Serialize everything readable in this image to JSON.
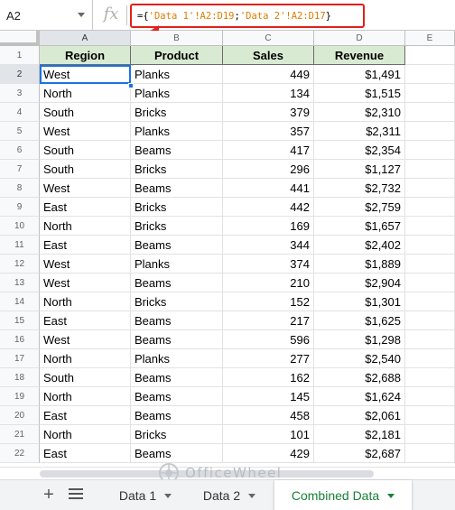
{
  "formula_bar": {
    "name_box": "A2",
    "fx_label": "fx",
    "formula_prefix": "={",
    "ref1": "'Data 1'!A2:D19",
    "separator": ";",
    "ref2": "'Data 2'!A2:D17",
    "formula_suffix": "}",
    "highlight_color": "#e0201a"
  },
  "columns": [
    "A",
    "B",
    "C",
    "D",
    "E"
  ],
  "headers": {
    "region": "Region",
    "product": "Product",
    "sales": "Sales",
    "revenue": "Revenue"
  },
  "header_fill": "#d9ead3",
  "rows": [
    {
      "n": "2",
      "region": "West",
      "product": "Planks",
      "sales": "449",
      "revenue": "$1,491"
    },
    {
      "n": "3",
      "region": "North",
      "product": "Planks",
      "sales": "134",
      "revenue": "$1,515"
    },
    {
      "n": "4",
      "region": "South",
      "product": "Bricks",
      "sales": "379",
      "revenue": "$2,310"
    },
    {
      "n": "5",
      "region": "West",
      "product": "Planks",
      "sales": "357",
      "revenue": "$2,311"
    },
    {
      "n": "6",
      "region": "South",
      "product": "Beams",
      "sales": "417",
      "revenue": "$2,354"
    },
    {
      "n": "7",
      "region": "South",
      "product": "Bricks",
      "sales": "296",
      "revenue": "$1,127"
    },
    {
      "n": "8",
      "region": "West",
      "product": "Beams",
      "sales": "441",
      "revenue": "$2,732"
    },
    {
      "n": "9",
      "region": "East",
      "product": "Bricks",
      "sales": "442",
      "revenue": "$2,759"
    },
    {
      "n": "10",
      "region": "North",
      "product": "Bricks",
      "sales": "169",
      "revenue": "$1,657"
    },
    {
      "n": "11",
      "region": "East",
      "product": "Beams",
      "sales": "344",
      "revenue": "$2,402"
    },
    {
      "n": "12",
      "region": "West",
      "product": "Planks",
      "sales": "374",
      "revenue": "$1,889"
    },
    {
      "n": "13",
      "region": "West",
      "product": "Beams",
      "sales": "210",
      "revenue": "$2,904"
    },
    {
      "n": "14",
      "region": "North",
      "product": "Bricks",
      "sales": "152",
      "revenue": "$1,301"
    },
    {
      "n": "15",
      "region": "East",
      "product": "Beams",
      "sales": "217",
      "revenue": "$1,625"
    },
    {
      "n": "16",
      "region": "West",
      "product": "Beams",
      "sales": "596",
      "revenue": "$1,298"
    },
    {
      "n": "17",
      "region": "North",
      "product": "Planks",
      "sales": "277",
      "revenue": "$2,540"
    },
    {
      "n": "18",
      "region": "South",
      "product": "Beams",
      "sales": "162",
      "revenue": "$2,688"
    },
    {
      "n": "19",
      "region": "North",
      "product": "Beams",
      "sales": "145",
      "revenue": "$1,624"
    },
    {
      "n": "20",
      "region": "East",
      "product": "Beams",
      "sales": "458",
      "revenue": "$2,061"
    },
    {
      "n": "21",
      "region": "North",
      "product": "Bricks",
      "sales": "101",
      "revenue": "$2,181"
    },
    {
      "n": "22",
      "region": "East",
      "product": "Beams",
      "sales": "429",
      "revenue": "$2,687"
    }
  ],
  "watermark": "OfficeWheel",
  "tabs": {
    "add_icon": "plus-icon",
    "list_icon": "list-icon",
    "items": [
      {
        "label": "Data 1"
      },
      {
        "label": "Data 2"
      },
      {
        "label": "Combined Data",
        "active": true
      }
    ],
    "active_color": "#188038"
  }
}
